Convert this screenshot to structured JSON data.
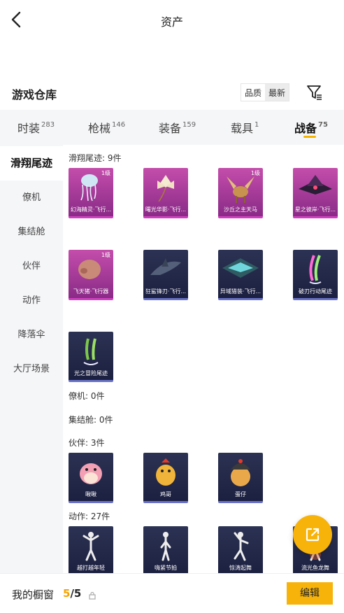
{
  "header": {
    "title": "资产"
  },
  "warehouse": {
    "title": "游戏仓库",
    "sort_quality": "品质",
    "sort_latest": "最新"
  },
  "tabs": [
    {
      "label": "时装",
      "count": "283"
    },
    {
      "label": "枪械",
      "count": "146"
    },
    {
      "label": "装备",
      "count": "159"
    },
    {
      "label": "载具",
      "count": "1"
    },
    {
      "label": "战备",
      "count": "75"
    }
  ],
  "sidebar": [
    "滑翔尾迹",
    "僚机",
    "集结舱",
    "伙伴",
    "动作",
    "降落伞",
    "大厅场景"
  ],
  "sections": {
    "glide": "滑翔尾迹: 9件",
    "wingman": "僚机: 0件",
    "capsule": "集结舱: 0件",
    "partner": "伙伴: 3件",
    "action": "动作: 27件"
  },
  "glide_items": [
    {
      "name": "幻海精灵·飞行...",
      "level": "1级",
      "rarity": "pink"
    },
    {
      "name": "曙光华影·飞行...",
      "level": "",
      "rarity": "pink"
    },
    {
      "name": "沙丘之主天马",
      "level": "1级",
      "rarity": "pink"
    },
    {
      "name": "星之彼岸·飞行...",
      "level": "",
      "rarity": "pink"
    },
    {
      "name": "飞天猪·飞行器",
      "level": "1级",
      "rarity": "pink"
    },
    {
      "name": "狂鲨锋刃·飞行...",
      "level": "",
      "rarity": "blue"
    },
    {
      "name": "异域猎装·飞行...",
      "level": "",
      "rarity": "blue"
    },
    {
      "name": "破刃行动尾迹",
      "level": "",
      "rarity": "blue"
    },
    {
      "name": "光之冒险尾迹",
      "level": "",
      "rarity": "blue"
    }
  ],
  "partner_items": [
    {
      "name": "啾啾"
    },
    {
      "name": "鸡哥"
    },
    {
      "name": "蛋仔"
    }
  ],
  "action_items": [
    {
      "name": "越打越年轻"
    },
    {
      "name": "嗨紧节拍"
    },
    {
      "name": "惊涛起舞"
    },
    {
      "name": "流光鱼龙舞"
    }
  ],
  "showcase": {
    "label": "我的橱窗",
    "current": "5",
    "total": "/5",
    "edit": "编辑"
  },
  "colors": {
    "accent": "#f7b30a",
    "pink_card": "#c44dab",
    "blue_card": "#2c3253"
  }
}
